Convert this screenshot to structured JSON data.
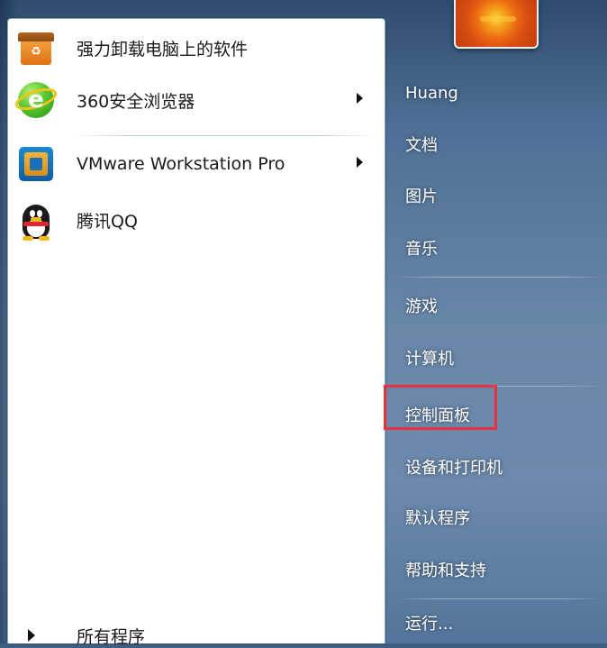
{
  "programs": [
    {
      "label": "强力卸载电脑上的软件",
      "icon": "uninstall-box-icon",
      "has_submenu": false
    },
    {
      "label": "360安全浏览器",
      "icon": "360-browser-icon",
      "has_submenu": true
    },
    {
      "label": "VMware Workstation Pro",
      "icon": "vmware-icon",
      "has_submenu": true
    },
    {
      "label": "腾讯QQ",
      "icon": "qq-penguin-icon",
      "has_submenu": false
    }
  ],
  "all_programs_label": "所有程序",
  "right_menu": [
    {
      "label": "Huang"
    },
    {
      "label": "文档"
    },
    {
      "label": "图片"
    },
    {
      "label": "音乐"
    },
    {
      "label": "游戏"
    },
    {
      "label": "计算机"
    },
    {
      "label": "控制面板",
      "highlighted": true
    },
    {
      "label": "设备和打印机"
    },
    {
      "label": "默认程序"
    },
    {
      "label": "帮助和支持"
    },
    {
      "label": "运行..."
    }
  ],
  "colors": {
    "highlight_box": "#e8323c",
    "menu_text_right": "#ffffff",
    "menu_text_left": "#1a1a1a"
  }
}
